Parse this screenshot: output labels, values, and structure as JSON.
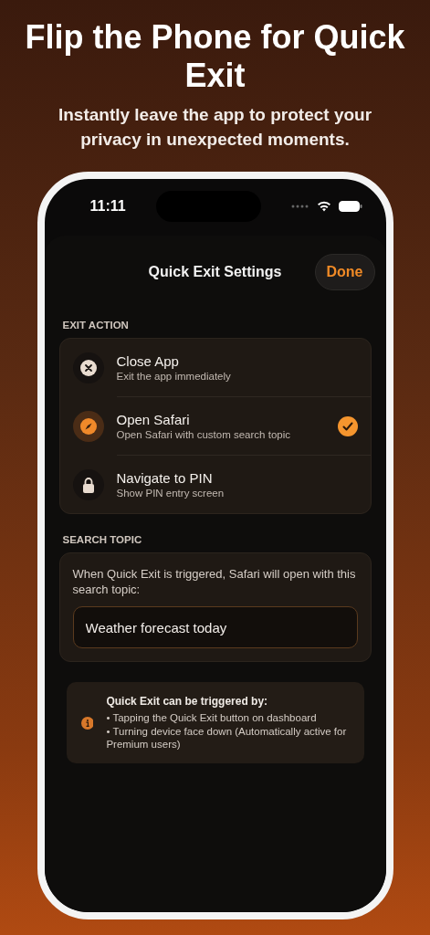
{
  "headline": "Flip the Phone for Quick Exit",
  "subtitle": "Instantly leave the app to protect your privacy in unexpected moments.",
  "status_bar": {
    "time": "11:11"
  },
  "sheet": {
    "title": "Quick Exit Settings",
    "done_button": "Done"
  },
  "exit_action": {
    "heading": "EXIT ACTION",
    "options": [
      {
        "kind": "close",
        "title": "Close App",
        "subtitle": "Exit the app immediately",
        "selected": false
      },
      {
        "kind": "compass",
        "title": "Open Safari",
        "subtitle": "Open Safari with custom search topic",
        "selected": true
      },
      {
        "kind": "lock",
        "title": "Navigate to PIN",
        "subtitle": "Show PIN entry screen",
        "selected": false
      }
    ]
  },
  "search_topic": {
    "heading": "SEARCH TOPIC",
    "description": "When Quick Exit is triggered, Safari will open with this search topic:",
    "value": "Weather forecast today"
  },
  "info": {
    "title": "Quick Exit can be triggered by:",
    "bullets": [
      "• Tapping the Quick Exit button on dashboard",
      "• Turning device face down (Automatically active for Premium users)"
    ]
  }
}
